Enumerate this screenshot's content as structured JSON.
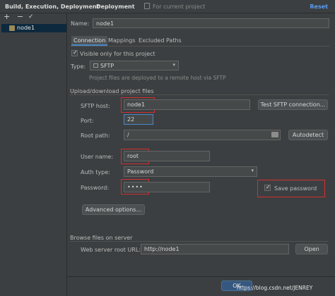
{
  "header": {
    "breadcrumb_1": "Build, Execution, Deployment",
    "separator": "›",
    "breadcrumb_2": "Deployment",
    "scope_label": "For current project",
    "reset_label": "Reset"
  },
  "toolbar": {
    "add": "+",
    "remove": "−",
    "check": "✓"
  },
  "tree": {
    "server_name": "node1"
  },
  "name_label": "Name:",
  "name_value": "node1",
  "tabs": [
    "Connection",
    "Mappings",
    "Excluded Paths"
  ],
  "visible_only_label": "Visible only for this project",
  "type_label": "Type:",
  "type_value": "SFTP",
  "type_hint": "Project files are deployed to a remote host via SFTP",
  "section_upload": "Upload/download project files",
  "sftp_host": {
    "label": "SFTP host:",
    "value": "node1",
    "button": "Test SFTP connection..."
  },
  "port": {
    "label": "Port:",
    "value": "22"
  },
  "root_path": {
    "label": "Root path:",
    "value": "/",
    "button": "Autodetect"
  },
  "user_name": {
    "label": "User name:",
    "value": "root"
  },
  "auth_type": {
    "label": "Auth type:",
    "value": "Password"
  },
  "password": {
    "label": "Password:",
    "value": "••••",
    "save_label": "Save password"
  },
  "advanced_button": "Advanced options...",
  "section_browse": "Browse files on server",
  "web_root": {
    "label": "Web server root URL:",
    "value": "http://node1",
    "button": "Open"
  },
  "ok_button": "OK",
  "watermark": "https://blog.csdn.net/JENREY",
  "colors": {
    "accent": "#589df6",
    "highlight": "#d32f2f",
    "background": "#3c3f41"
  }
}
